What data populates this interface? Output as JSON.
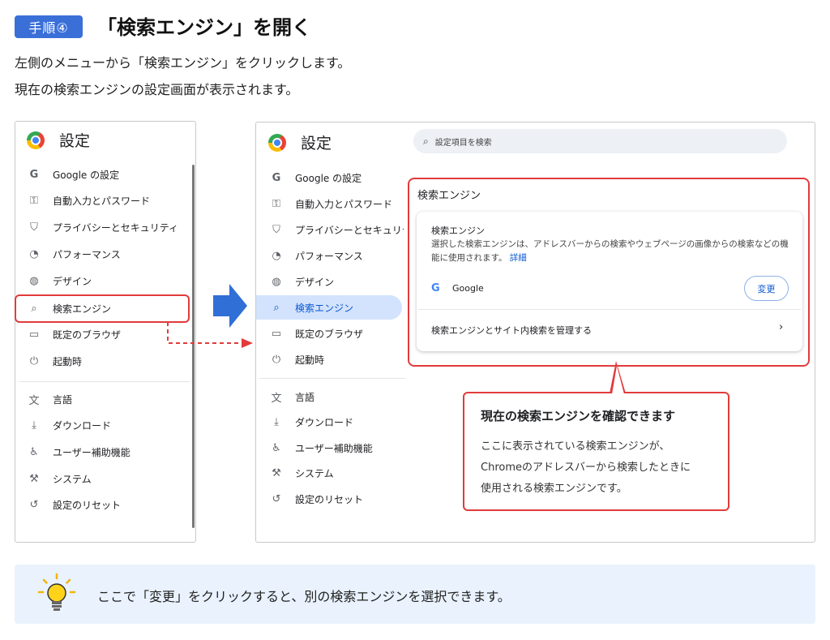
{
  "header": {
    "step_badge": "手順④",
    "title": "「検索エンジン」を開く",
    "desc_line1": "左側のメニューから「検索エンジン」をクリックします。",
    "desc_line2": "現在の検索エンジンの設定画面が表示されます。"
  },
  "left_panel": {
    "title": "設定",
    "menu": [
      {
        "icon": "G",
        "label": "Google の設定"
      },
      {
        "icon": "⚿",
        "label": "自動入力とパスワード"
      },
      {
        "icon": "⛉",
        "label": "プライバシーとセキュリティ"
      },
      {
        "icon": "◔",
        "label": "パフォーマンス"
      },
      {
        "icon": "◍",
        "label": "デザイン"
      },
      {
        "icon": "⌕",
        "label": "検索エンジン"
      },
      {
        "icon": "▭",
        "label": "既定のブラウザ"
      },
      {
        "icon": "⏻",
        "label": "起動時"
      },
      {
        "icon": "文",
        "label": "言語"
      },
      {
        "icon": "⤓",
        "label": "ダウンロード"
      },
      {
        "icon": "♿",
        "label": "ユーザー補助機能"
      },
      {
        "icon": "⚒",
        "label": "システム"
      },
      {
        "icon": "↺",
        "label": "設定のリセット"
      }
    ]
  },
  "right_panel": {
    "title": "設定",
    "search_placeholder": "設定項目を検索",
    "menu": [
      {
        "icon": "G",
        "label": "Google の設定"
      },
      {
        "icon": "⚿",
        "label": "自動入力とパスワード"
      },
      {
        "icon": "⛉",
        "label": "プライバシーとセキュリテ"
      },
      {
        "icon": "◔",
        "label": "パフォーマンス"
      },
      {
        "icon": "◍",
        "label": "デザイン"
      },
      {
        "icon": "⌕",
        "label": "検索エンジン"
      },
      {
        "icon": "▭",
        "label": "既定のブラウザ"
      },
      {
        "icon": "⏻",
        "label": "起動時"
      },
      {
        "icon": "文",
        "label": "言語"
      },
      {
        "icon": "⤓",
        "label": "ダウンロード"
      },
      {
        "icon": "♿",
        "label": "ユーザー補助機能"
      },
      {
        "icon": "⚒",
        "label": "システム"
      },
      {
        "icon": "↺",
        "label": "設定のリセット"
      }
    ],
    "section_title": "検索エンジン",
    "card": {
      "heading": "検索エンジン",
      "description": "選択した検索エンジンは、アドレスバーからの検索やウェブページの画像からの検索などの機能に使用されます。",
      "detail_link": "詳細",
      "engine_name": "Google",
      "change_button": "変更",
      "manage_link": "検索エンジンとサイト内検索を管理する"
    }
  },
  "callout": {
    "title": "現在の検索エンジンを確認できます",
    "body_line1": "ここに表示されている検索エンジンが、",
    "body_line2": "Chromeのアドレスバーから検索したときに",
    "body_line3": "使用される検索エンジンです。"
  },
  "tip": {
    "text": "ここで「変更」をクリックすると、別の検索エンジンを選択できます。"
  },
  "colors": {
    "accent_blue": "#3a6fd8",
    "highlight_red": "#e23b3b",
    "tip_background": "#e9f2fd",
    "active_menu_bg": "#d3e3fd"
  }
}
